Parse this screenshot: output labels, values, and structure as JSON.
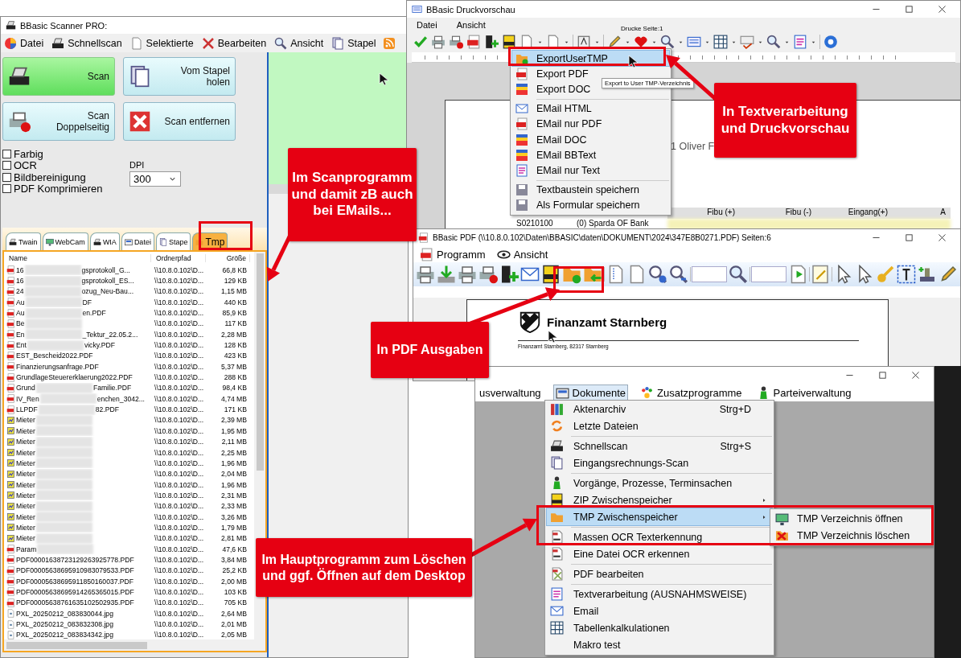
{
  "scanner_window": {
    "title": "BBasic Scanner PRO:",
    "menu": [
      "Datei",
      "Schnellscan",
      "Selektierte",
      "Bearbeiten",
      "Ansicht",
      "Stapel"
    ],
    "buttons": [
      {
        "label": "Scan",
        "highlighted": true
      },
      {
        "label": "Vom Stapel holen",
        "highlighted": false
      },
      {
        "label": "Scan Doppelseitig",
        "highlighted": false
      },
      {
        "label": "Scan entfernen",
        "highlighted": false
      }
    ],
    "options": [
      {
        "label": "Farbig",
        "checked": false
      },
      {
        "label": "OCR",
        "checked": false
      },
      {
        "label": "Bildbereinigung",
        "checked": false
      },
      {
        "label": "PDF Komprimieren",
        "checked": false
      }
    ],
    "dpi": {
      "label": "DPI",
      "value": "300"
    },
    "tabs": [
      {
        "label": "Twain",
        "selected": false
      },
      {
        "label": "WebCam",
        "selected": false
      },
      {
        "label": "WIA",
        "selected": false
      },
      {
        "label": "Datei",
        "selected": false
      },
      {
        "label": "Stape",
        "selected": false
      },
      {
        "label": "Tmp",
        "selected": true
      }
    ],
    "file_list": {
      "columns": [
        "Name",
        "Ordnerpfad",
        "Größe"
      ],
      "rows": [
        {
          "kind": "pdf",
          "name": "16",
          "blurred": true,
          "name_end": "gsprotokoll_G...",
          "path": "\\\\10.8.0.102\\D...",
          "size": "66,8 KB"
        },
        {
          "kind": "pdf",
          "name": "16",
          "blurred": true,
          "name_end": "gsprotokoll_ES...",
          "path": "\\\\10.8.0.102\\D...",
          "size": "129 KB"
        },
        {
          "kind": "pdf",
          "name": "24",
          "blurred": true,
          "name_end": "ozug_Neu-Bau...",
          "path": "\\\\10.8.0.102\\D...",
          "size": "1,15 MB"
        },
        {
          "kind": "pdf",
          "name": "Au",
          "blurred": true,
          "name_end": "DF",
          "path": "\\\\10.8.0.102\\D...",
          "size": "440 KB"
        },
        {
          "kind": "pdf",
          "name": "Au",
          "blurred": true,
          "name_end": "en.PDF",
          "path": "\\\\10.8.0.102\\D...",
          "size": "85,9 KB"
        },
        {
          "kind": "pdf",
          "name": "Be",
          "blurred": true,
          "path": "\\\\10.8.0.102\\D...",
          "size": "117 KB"
        },
        {
          "kind": "pdf",
          "name": "En",
          "blurred": true,
          "name_end": "_Tektur_22.05.2...",
          "path": "\\\\10.8.0.102\\D...",
          "size": "2,28 MB"
        },
        {
          "kind": "pdf",
          "name": "Ent",
          "blurred": true,
          "name_end": "vicky.PDF",
          "path": "\\\\10.8.0.102\\D...",
          "size": "128 KB"
        },
        {
          "kind": "pdf",
          "name": "EST_Bescheid2022.PDF",
          "blurred": false,
          "path": "\\\\10.8.0.102\\D...",
          "size": "423 KB"
        },
        {
          "kind": "pdf",
          "name": "Finanzierungsanfrage.PDF",
          "blurred": false,
          "path": "\\\\10.8.0.102\\D...",
          "size": "5,37 MB"
        },
        {
          "kind": "pdf",
          "name": "GrundlageSteuererklaerung2022.PDF",
          "blurred": false,
          "path": "\\\\10.8.0.102\\D...",
          "size": "288 KB"
        },
        {
          "kind": "pdf",
          "name": "Grund",
          "blurred": true,
          "name_end": "Familie.PDF",
          "path": "\\\\10.8.0.102\\D...",
          "size": "98,4 KB"
        },
        {
          "kind": "pdf",
          "name": "IV_Ren",
          "blurred": true,
          "name_end": "enchen_3042...",
          "path": "\\\\10.8.0.102\\D...",
          "size": "4,74 MB"
        },
        {
          "kind": "pdf",
          "name": "LLPDF",
          "blurred": true,
          "name_end": "82.PDF",
          "path": "\\\\10.8.0.102\\D...",
          "size": "171 KB"
        },
        {
          "kind": "image",
          "name": "Mieter",
          "blurred": true,
          "path": "\\\\10.8.0.102\\D...",
          "size": "2,39 MB"
        },
        {
          "kind": "image",
          "name": "Mieter",
          "blurred": true,
          "path": "\\\\10.8.0.102\\D...",
          "size": "1,95 MB"
        },
        {
          "kind": "image",
          "name": "Mieter",
          "blurred": true,
          "path": "\\\\10.8.0.102\\D...",
          "size": "2,11 MB"
        },
        {
          "kind": "image",
          "name": "Mieter",
          "blurred": true,
          "path": "\\\\10.8.0.102\\D...",
          "size": "2,25 MB"
        },
        {
          "kind": "image",
          "name": "Mieter",
          "blurred": true,
          "path": "\\\\10.8.0.102\\D...",
          "size": "1,96 MB"
        },
        {
          "kind": "image",
          "name": "Mieter",
          "blurred": true,
          "path": "\\\\10.8.0.102\\D...",
          "size": "2,04 MB"
        },
        {
          "kind": "image",
          "name": "Mieter",
          "blurred": true,
          "path": "\\\\10.8.0.102\\D...",
          "size": "1,96 MB"
        },
        {
          "kind": "image",
          "name": "Mieter",
          "blurred": true,
          "path": "\\\\10.8.0.102\\D...",
          "size": "2,31 MB"
        },
        {
          "kind": "image",
          "name": "Mieter",
          "blurred": true,
          "path": "\\\\10.8.0.102\\D...",
          "size": "2,33 MB"
        },
        {
          "kind": "image",
          "name": "Mieter",
          "blurred": true,
          "path": "\\\\10.8.0.102\\D...",
          "size": "3,26 MB"
        },
        {
          "kind": "image",
          "name": "Mieter",
          "blurred": true,
          "path": "\\\\10.8.0.102\\D...",
          "size": "1,79 MB"
        },
        {
          "kind": "image",
          "name": "Mieter",
          "blurred": true,
          "path": "\\\\10.8.0.102\\D...",
          "size": "2,81 MB"
        },
        {
          "kind": "pdf",
          "name": "Param",
          "blurred": true,
          "path": "\\\\10.8.0.102\\D...",
          "size": "47,6 KB"
        },
        {
          "kind": "pdf",
          "name": "PDF00001638723129263925778.PDF",
          "blurred": false,
          "path": "\\\\10.8.0.102\\D...",
          "size": "3,84 MB"
        },
        {
          "kind": "pdf",
          "name": "PDF00005638695910983079533.PDF",
          "blurred": false,
          "path": "\\\\10.8.0.102\\D...",
          "size": "25,2 KB"
        },
        {
          "kind": "pdf",
          "name": "PDF00005638695911850160037.PDF",
          "blurred": false,
          "path": "\\\\10.8.0.102\\D...",
          "size": "2,00 MB"
        },
        {
          "kind": "pdf",
          "name": "PDF00005638695914265365015.PDF",
          "blurred": false,
          "path": "\\\\10.8.0.102\\D...",
          "size": "103 KB"
        },
        {
          "kind": "pdf",
          "name": "PDF00005638761635102502935.PDF",
          "blurred": false,
          "path": "\\\\10.8.0.102\\D...",
          "size": "705 KB"
        },
        {
          "kind": "jpg",
          "name": "PXL_20250212_083830044.jpg",
          "blurred": false,
          "path": "\\\\10.8.0.102\\D...",
          "size": "2,64 MB"
        },
        {
          "kind": "jpg",
          "name": "PXL_20250212_083832308.jpg",
          "blurred": false,
          "path": "\\\\10.8.0.102\\D...",
          "size": "2,01 MB"
        },
        {
          "kind": "jpg",
          "name": "PXL_20250212_083834342.jpg",
          "blurred": false,
          "path": "\\\\10.8.0.102\\D...",
          "size": "2,05 MB"
        }
      ]
    }
  },
  "preview_window": {
    "title": "BBasic Druckvorschau",
    "menu": [
      "Datei",
      "Ansicht"
    ],
    "page_indicator": "Drucke Seite:1",
    "export_menu": [
      {
        "label": "ExportUserTMP",
        "selected": true,
        "separator_before": false
      },
      {
        "label": "Export PDF",
        "selected": false,
        "separator_before": false
      },
      {
        "label": "Export DOC",
        "selected": false,
        "separator_before": false
      },
      {
        "label": "EMail HTML",
        "selected": false,
        "separator_before": true
      },
      {
        "label": "EMail nur PDF",
        "selected": false,
        "separator_before": false
      },
      {
        "label": "EMail DOC",
        "selected": false,
        "separator_before": false
      },
      {
        "label": "EMail BBText",
        "selected": false,
        "separator_before": false
      },
      {
        "label": "EMail nur Text",
        "selected": false,
        "separator_before": false
      },
      {
        "label": "Textbaustein speichern",
        "selected": false,
        "separator_before": true
      },
      {
        "label": "Als Formular speichern",
        "selected": false,
        "separator_before": false
      }
    ],
    "tooltip": "Export to User TMP-Verzeichnis",
    "document": {
      "text": "1 Oliver F",
      "columns": [
        "Fibu (+)",
        "Fibu (-)",
        "Eingang(+)",
        "A"
      ],
      "row": [
        "S0210100",
        "(0) Sparda OF Bank"
      ]
    }
  },
  "pdf_window": {
    "title": "BBasic PDF (\\\\10.8.0.102\\Daten\\BBASIC\\daten\\DOKUMENT\\2024\\347E8B0271.PDF)  Seiten:6",
    "menu": [
      "Programm",
      "Ansicht"
    ],
    "document": {
      "heading": "Finanzamt Starnberg",
      "sender_line": "Finanzamt Starnberg, 82317 Starnberg"
    }
  },
  "main_window": {
    "menu": [
      {
        "label": "usverwaltung",
        "selected": false
      },
      {
        "label": "Dokumente",
        "selected": true
      },
      {
        "label": "Zusatzprogramme",
        "selected": false
      },
      {
        "label": "Parteiverwaltung",
        "selected": false
      }
    ],
    "dokumente_menu": [
      {
        "label": "Aktenarchiv",
        "shortcut": "Strg+D",
        "has_submenu": false,
        "selected": false,
        "separator_before": false
      },
      {
        "label": "Letzte Dateien",
        "has_submenu": false,
        "selected": false,
        "separator_before": false
      },
      {
        "label": "Schnellscan",
        "shortcut": "Strg+S",
        "has_submenu": false,
        "selected": false,
        "separator_before": true
      },
      {
        "label": "Eingangsrechnungs-Scan",
        "has_submenu": false,
        "selected": false,
        "separator_before": false
      },
      {
        "label": "Vorgänge, Prozesse, Terminsachen",
        "has_submenu": false,
        "selected": false,
        "separator_before": true
      },
      {
        "label": "ZIP Zwischenspeicher",
        "has_submenu": true,
        "selected": false,
        "separator_before": false
      },
      {
        "label": "TMP Zwischenspeicher",
        "has_submenu": true,
        "selected": true,
        "separator_before": false
      },
      {
        "label": "Massen OCR Texterkennung",
        "has_submenu": false,
        "selected": false,
        "separator_before": true
      },
      {
        "label": "Eine Datei OCR erkennen",
        "has_submenu": false,
        "selected": false,
        "separator_before": false
      },
      {
        "label": "PDF bearbeiten",
        "has_submenu": false,
        "selected": false,
        "separator_before": true
      },
      {
        "label": "Textverarbeitung (AUSNAHMSWEISE)",
        "has_submenu": false,
        "selected": false,
        "separator_before": true
      },
      {
        "label": "Email",
        "has_submenu": false,
        "selected": false,
        "separator_before": false
      },
      {
        "label": "Tabellenkalkulationen",
        "has_submenu": false,
        "selected": false,
        "separator_before": false
      },
      {
        "label": "Makro test",
        "has_submenu": false,
        "selected": false,
        "separator_before": false
      }
    ],
    "tmp_submenu": [
      "TMP Verzeichnis öffnen",
      "TMP Verzeichnis löschen"
    ]
  },
  "callouts": [
    {
      "text": "Im Scanprogramm und damit zB auch bei EMails..."
    },
    {
      "text": "In Textverarbeitung und Druckvorschau"
    },
    {
      "text": "In PDF Ausgaben"
    },
    {
      "text": "Im Hauptprogramm zum Löschen und ggf. Öffnen auf dem Desktop"
    }
  ]
}
